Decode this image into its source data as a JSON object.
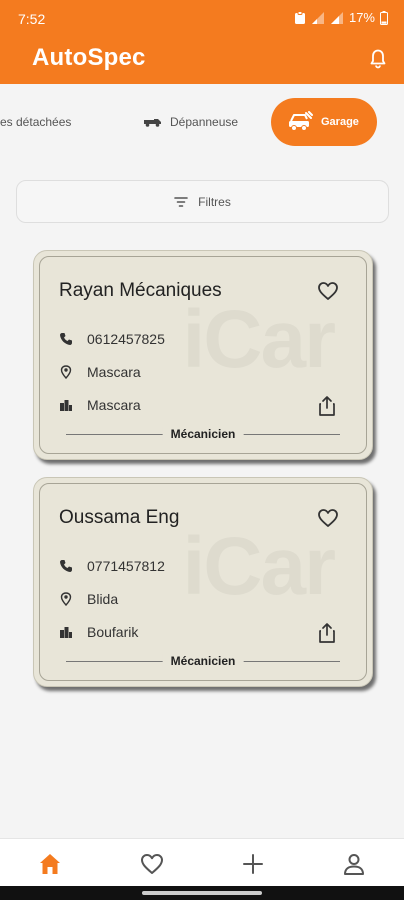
{
  "status": {
    "time": "7:52",
    "battery": "17%"
  },
  "app": {
    "title": "AutoSpec"
  },
  "categories": [
    {
      "label": "Pièces détachées",
      "visible_label": "ces détachées",
      "active": false,
      "icon": "parts-icon"
    },
    {
      "label": "Dépanneuse",
      "active": false,
      "icon": "tow-truck-icon"
    },
    {
      "label": "Garage",
      "active": true,
      "icon": "garage-car-icon"
    }
  ],
  "filters": {
    "label": "Filtres"
  },
  "watermark": "iCar",
  "cards": [
    {
      "name": "Rayan Mécaniques",
      "phone": "0612457825",
      "wilaya": "Mascara",
      "commune": "Mascara",
      "type": "Mécanicien"
    },
    {
      "name": "Oussama Eng",
      "phone": "0771457812",
      "wilaya": "Blida",
      "commune": "Boufarik",
      "type": "Mécanicien"
    }
  ],
  "nav": [
    "home-icon",
    "favorites-icon",
    "add-icon",
    "profile-icon"
  ],
  "colors": {
    "accent": "#f47b1f",
    "card": "#e8e5d8"
  }
}
